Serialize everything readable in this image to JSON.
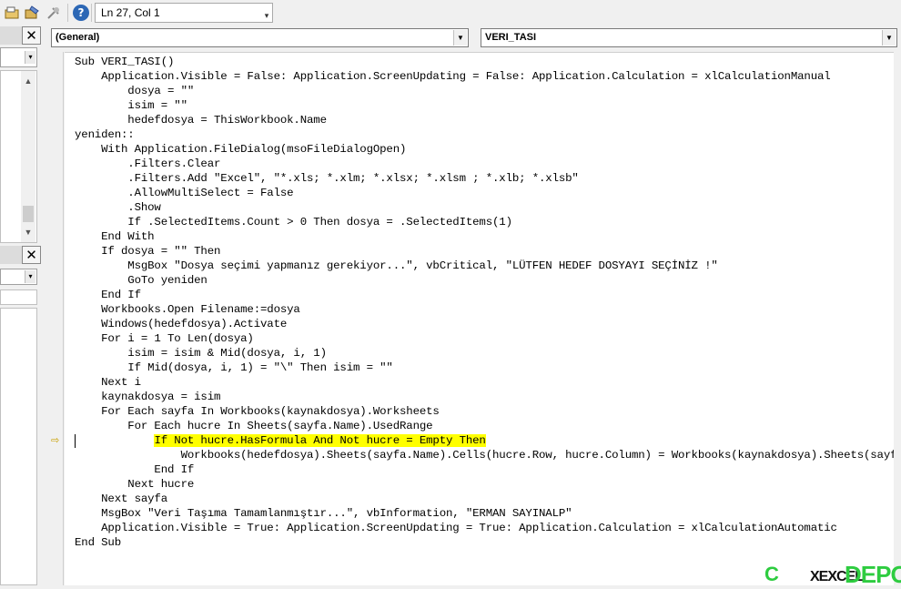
{
  "toolbar": {
    "icons": [
      "project-explorer-icon",
      "properties-icon",
      "object-browser-icon",
      "help-icon"
    ],
    "help_glyph": "?",
    "status": "Ln 27, Col 1"
  },
  "left_panes": {
    "close_glyph": "✕"
  },
  "code_window": {
    "object_combo": "(General)",
    "procedure_combo": "VERI_TASI",
    "execution_line_index": 26,
    "lines": [
      "Sub VERI_TASI()",
      "    Application.Visible = False: Application.ScreenUpdating = False: Application.Calculation = xlCalculationManual",
      "        dosya = \"\"",
      "        isim = \"\"",
      "        hedefdosya = ThisWorkbook.Name",
      "yeniden::",
      "    With Application.FileDialog(msoFileDialogOpen)",
      "        .Filters.Clear",
      "        .Filters.Add \"Excel\", \"*.xls; *.xlm; *.xlsx; *.xlsm ; *.xlb; *.xlsb\"",
      "        .AllowMultiSelect = False",
      "        .Show",
      "        If .SelectedItems.Count > 0 Then dosya = .SelectedItems(1)",
      "    End With",
      "    If dosya = \"\" Then",
      "        MsgBox \"Dosya seçimi yapmanız gerekiyor...\", vbCritical, \"LÜTFEN HEDEF DOSYAYI SEÇİNİZ !\"",
      "        GoTo yeniden",
      "    End If",
      "    Workbooks.Open Filename:=dosya",
      "    Windows(hedefdosya).Activate",
      "    For i = 1 To Len(dosya)",
      "        isim = isim & Mid(dosya, i, 1)",
      "        If Mid(dosya, i, 1) = \"\\\" Then isim = \"\"",
      "    Next i",
      "    kaynakdosya = isim",
      "    For Each sayfa In Workbooks(kaynakdosya).Worksheets",
      "        For Each hucre In Sheets(sayfa.Name).UsedRange",
      "            If Not hucre.HasFormula And Not hucre = Empty Then",
      "                Workbooks(hedefdosya).Sheets(sayfa.Name).Cells(hucre.Row, hucre.Column) = Workbooks(kaynakdosya).Sheets(sayfa.Name).Cells(hucre.Row, hucre.Column)",
      "            End If",
      "        Next hucre",
      "    Next sayfa",
      "    MsgBox \"Veri Taşıma Tamamlanmıştır...\", vbInformation, \"ERMAN SAYINALP\"",
      "    Application.Visible = True: Application.ScreenUpdating = True: Application.Calculation = xlCalculationAutomatic",
      "End Sub"
    ]
  },
  "colors": {
    "highlight": "#ffff00",
    "indicator": "#c8a000",
    "watermark": "#2ecc40"
  },
  "watermark": {
    "c": "C",
    "x": "XEXCEL",
    "depo": "DEPO"
  }
}
